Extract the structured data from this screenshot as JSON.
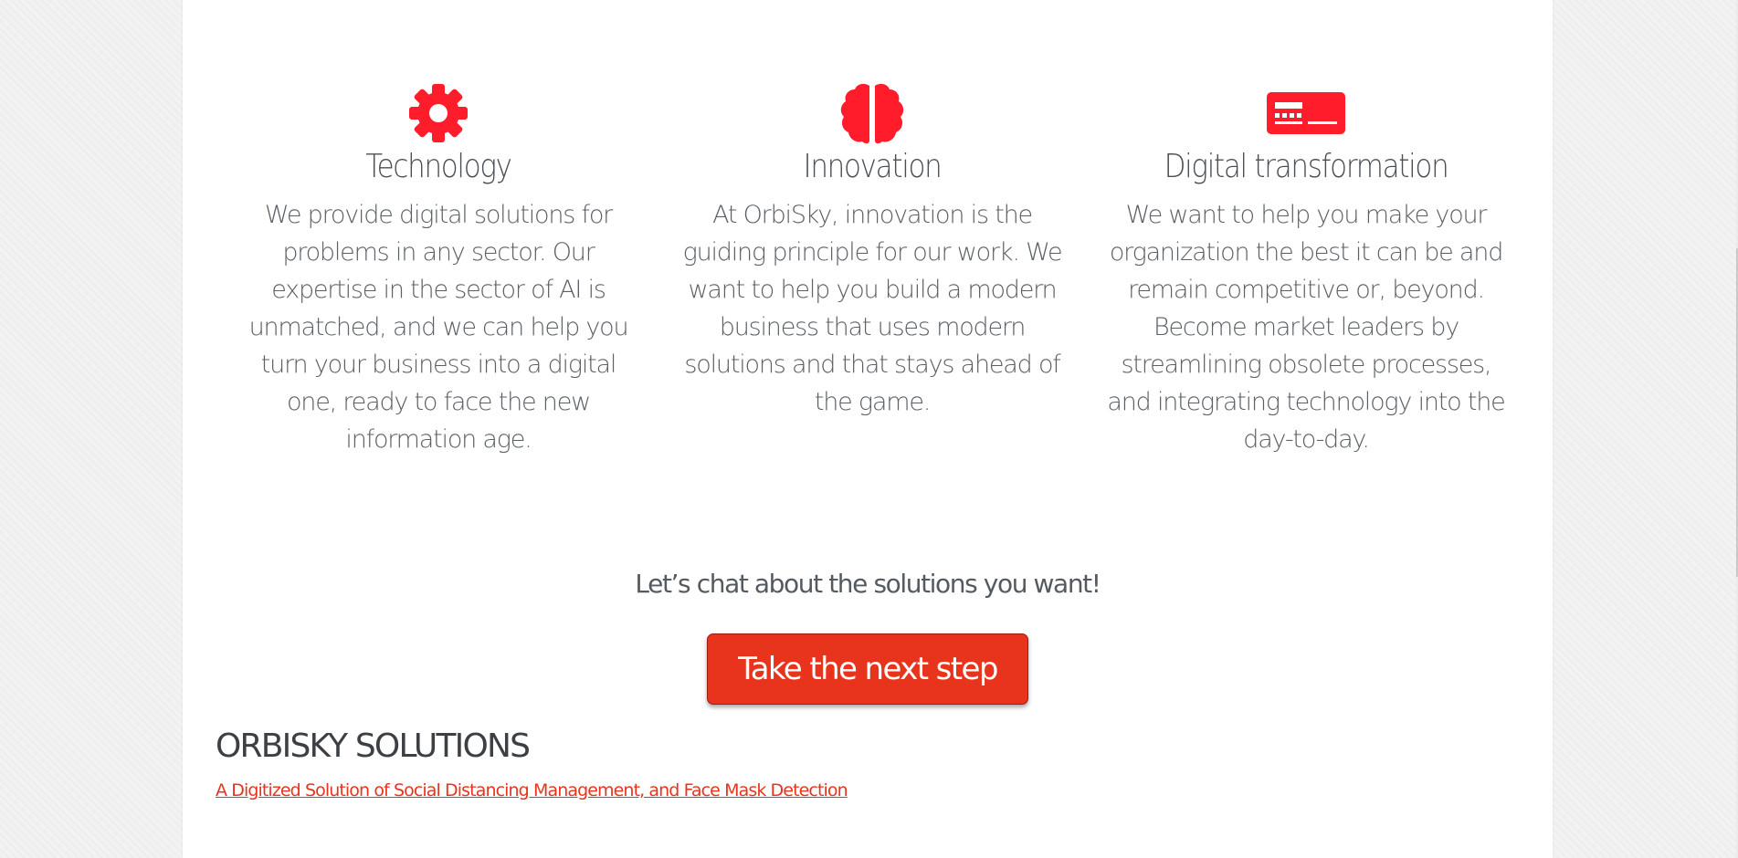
{
  "colors": {
    "accent": "#ff1d2b",
    "button": "#e8341c",
    "text": "#555a60",
    "background": "#ffffff"
  },
  "features": [
    {
      "icon": "gear-icon",
      "title": "Technology",
      "text": "We provide digital solutions for problems in any sector. Our expertise in the sector of AI is unmatched, and we can help you turn your business into a digital one, ready to face the new information age."
    },
    {
      "icon": "brain-icon",
      "title": "Innovation",
      "text": "At OrbiSky, innovation is the guiding principle for our work. We want to help you build a modern business that uses modern solutions and that stays ahead of the game."
    },
    {
      "icon": "card-icon",
      "title": "Digital transformation",
      "text": "We want to help you make your organization the best it can be and remain competitive or, beyond. Become market leaders by streamlining obsolete processes, and integrating technology into the day-to-day."
    }
  ],
  "cta": {
    "lead": "Let’s chat about the solutions you want!",
    "button_label": "Take the next step"
  },
  "footer": {
    "heading": "ORBISKY SOLUTIONS",
    "link_text": "A Digitized Solution of Social Distancing Management, and Face Mask Detection"
  }
}
